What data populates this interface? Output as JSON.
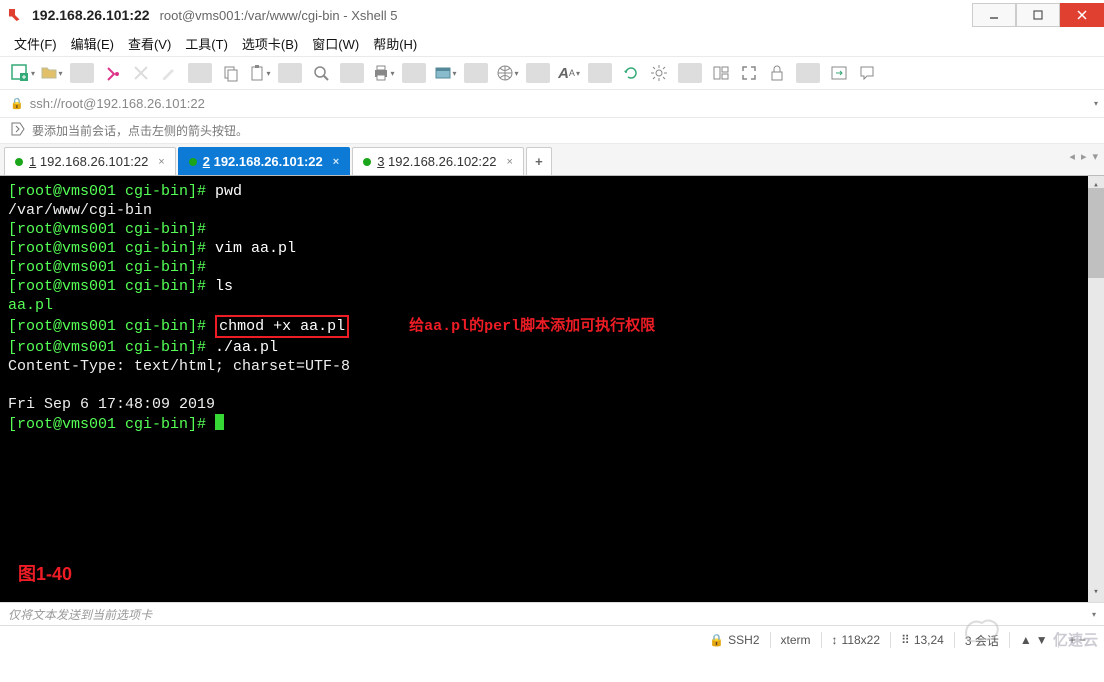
{
  "window": {
    "title": "192.168.26.101:22",
    "subtitle": "root@vms001:/var/www/cgi-bin - Xshell 5"
  },
  "menu": {
    "file": "文件(F)",
    "edit": "编辑(E)",
    "view": "查看(V)",
    "tools": "工具(T)",
    "tabs": "选项卡(B)",
    "window": "窗口(W)",
    "help": "帮助(H)"
  },
  "address": {
    "url": "ssh://root@192.168.26.101:22"
  },
  "hint": {
    "text": "要添加当前会话，点击左侧的箭头按钮。"
  },
  "tabs": [
    {
      "num": "1",
      "label": "192.168.26.101:22",
      "active": false
    },
    {
      "num": "2",
      "label": "192.168.26.101:22",
      "active": true
    },
    {
      "num": "3",
      "label": "192.168.26.102:22",
      "active": false
    }
  ],
  "terminal": {
    "lines": [
      {
        "prompt": "[root@vms001 cgi-bin]#",
        "cmd": " pwd"
      },
      {
        "plain": "/var/www/cgi-bin"
      },
      {
        "prompt": "[root@vms001 cgi-bin]#",
        "cmd": ""
      },
      {
        "prompt": "[root@vms001 cgi-bin]#",
        "cmd": " vim aa.pl"
      },
      {
        "prompt": "[root@vms001 cgi-bin]#",
        "cmd": ""
      },
      {
        "prompt": "[root@vms001 cgi-bin]#",
        "cmd": " ls"
      },
      {
        "plain_green": "aa.pl"
      },
      {
        "prompt": "[root@vms001 cgi-bin]#",
        "boxcmd": "chmod +x aa.pl",
        "annotation": "给aa.pl的perl脚本添加可执行权限"
      },
      {
        "prompt": "[root@vms001 cgi-bin]#",
        "cmd": " ./aa.pl"
      },
      {
        "plain": "Content-Type: text/html; charset=UTF-8"
      },
      {
        "plain": ""
      },
      {
        "plain": "Fri Sep  6 17:48:09 2019"
      },
      {
        "prompt": "[root@vms001 cgi-bin]#",
        "cursor": true
      }
    ],
    "fig_label": "图1-40"
  },
  "input": {
    "placeholder": "仅将文本发送到当前选项卡"
  },
  "status": {
    "protocol": "SSH2",
    "term": "xterm",
    "size": "118x22",
    "pos": "13,24",
    "sessions": "3 会话",
    "size_icon": "↕",
    "pos_icon": "⠿",
    "lock_icon": "🔒",
    "caps": "+  −"
  },
  "watermark": "亿速云"
}
